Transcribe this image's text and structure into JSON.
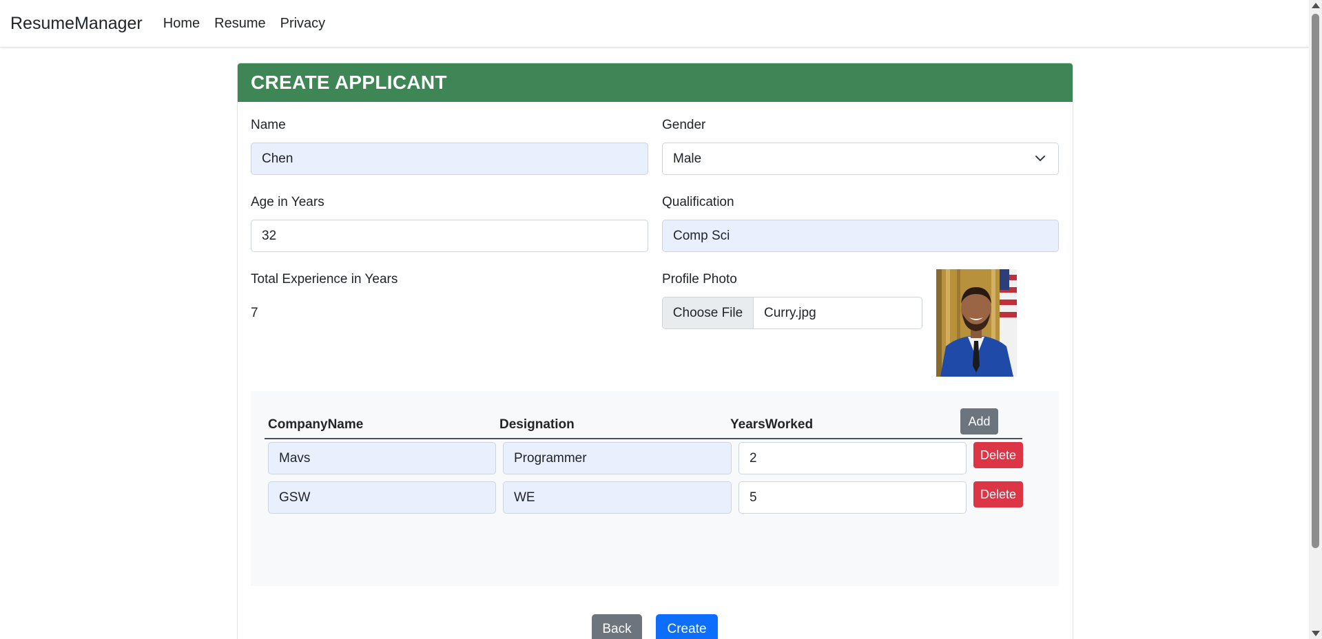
{
  "navbar": {
    "brand": "ResumeManager",
    "links": [
      "Home",
      "Resume",
      "Privacy"
    ]
  },
  "card": {
    "title": "CREATE APPLICANT",
    "header_color": "#3f8656"
  },
  "form": {
    "name": {
      "label": "Name",
      "value": "Chen"
    },
    "gender": {
      "label": "Gender",
      "value": "Male"
    },
    "age": {
      "label": "Age in Years",
      "value": "32"
    },
    "qualification": {
      "label": "Qualification",
      "value": "Comp Sci"
    },
    "total_experience": {
      "label": "Total Experience in Years",
      "value": "7"
    },
    "profile_photo": {
      "label": "Profile Photo",
      "button": "Choose File",
      "file_name": "Curry.jpg"
    }
  },
  "experience": {
    "headers": [
      "CompanyName",
      "Designation",
      "YearsWorked"
    ],
    "add_label": "Add",
    "delete_label": "Delete",
    "rows": [
      {
        "company": "Mavs",
        "designation": "Programmer",
        "years": "2"
      },
      {
        "company": "GSW",
        "designation": "WE",
        "years": "5"
      }
    ]
  },
  "actions": {
    "back_label": "Back",
    "create_label": "Create"
  },
  "colors": {
    "add_button": "#6c757d",
    "delete_button": "#dc3545",
    "create_button": "#0d6efd",
    "autofill": "#e8f0fe"
  }
}
